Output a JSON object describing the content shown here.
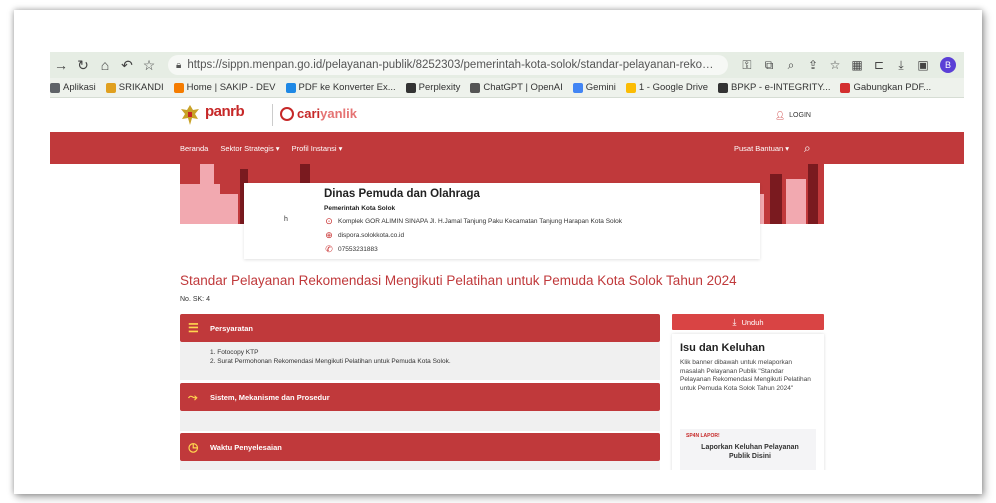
{
  "browser": {
    "url": "https://sippn.menpan.go.id/pelayanan-publik/8252303/pemerintah-kota-solok/standar-pelayanan-rekome...",
    "profile_initial": "B",
    "bookmarks": [
      {
        "label": "Aplikasi",
        "color": "#5f6368"
      },
      {
        "label": "SRIKANDI",
        "color": "#e0a020"
      },
      {
        "label": "Home | SAKIP - DEV",
        "color": "#f57c00"
      },
      {
        "label": "PDF ke Konverter Ex...",
        "color": "#1e88e5"
      },
      {
        "label": "Perplexity",
        "color": "#333333"
      },
      {
        "label": "ChatGPT | OpenAI",
        "color": "#555555"
      },
      {
        "label": "Gemini",
        "color": "#4285f4"
      },
      {
        "label": "1 - Google Drive",
        "color": "#fbbc04"
      },
      {
        "label": "BPKP - e-INTEGRITY...",
        "color": "#333333"
      },
      {
        "label": "Gabungkan PDF...",
        "color": "#d32f2f"
      }
    ]
  },
  "site": {
    "logo": "panrb",
    "brand_cari": "cari",
    "brand_yanlik": "yanlik",
    "login": "LOGIN",
    "nav": [
      "Beranda",
      "Sektor Strategis ▾",
      "Profil Instansi ▾"
    ],
    "help": "Pusat Bantuan ▾"
  },
  "agency": {
    "h_letter": "h",
    "name": "Dinas Pemuda dan Olahraga",
    "parent": "Pemerintah Kota Solok",
    "address": "Komplek GOR ALIMIN SINAPA Jl. H.Jamal Tanjung Paku Kecamatan Tanjung Harapan Kota Solok",
    "website": "dispora.solokkota.co.id",
    "phone": "07553231883"
  },
  "page": {
    "title": "Standar Pelayanan Rekomendasi Mengikuti Pelatihan untuk Pemuda Kota Solok Tahun 2024",
    "no_sk": "No. SK: 4"
  },
  "sections": {
    "persyaratan": {
      "title": "Persyaratan",
      "items": [
        "1. Fotocopy KTP",
        "2. Surat Permohonan Rekomendasi Mengikuti Pelatihan untuk Pemuda Kota Solok."
      ]
    },
    "sistem": {
      "title": "Sistem, Mekanisme dan Prosedur"
    },
    "waktu": {
      "title": "Waktu Penyelesaian"
    }
  },
  "sidebar": {
    "download": "Unduh",
    "isu_title": "Isu dan Keluhan",
    "isu_desc": "Klik banner dibawah untuk melaporkan masalah Pelayanan Publik \"Standar Pelayanan Rekomendasi Mengikuti Pelatihan untuk Pemuda Kota Solok Tahun 2024\"",
    "banner_logo": "SP4N LAPOR!",
    "banner_text": "Laporkan Keluhan Pelayanan Publik Disini"
  },
  "colors": {
    "brand_red": "#c0393b",
    "accent_yellow": "#ffd54f"
  }
}
